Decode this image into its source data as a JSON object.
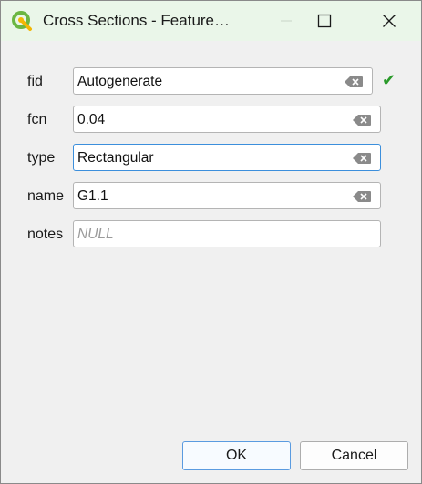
{
  "window": {
    "title": "Cross Sections - Feature…"
  },
  "fields": [
    {
      "label": "fid",
      "value": "Autogenerate",
      "null": false,
      "clear_icon": "backspace-clear-icon",
      "status_icon": "checkmark-icon",
      "status_glyph": "✔"
    },
    {
      "label": "fcn",
      "value": "0.04",
      "null": false,
      "clear_icon": "backspace-clear-icon"
    },
    {
      "label": "type",
      "value": "Rectangular",
      "null": false,
      "focused": true,
      "clear_icon": "backspace-clear-icon"
    },
    {
      "label": "name",
      "value": "G1.1",
      "null": false,
      "clear_icon": "backspace-clear-icon"
    },
    {
      "label": "notes",
      "value": "NULL",
      "null": true
    }
  ],
  "buttons": {
    "ok_label": "OK",
    "cancel_label": "Cancel"
  },
  "colors": {
    "titlebar": "#eaf6e9",
    "accent": "#3c8fdc",
    "check": "#2a9a2a"
  }
}
